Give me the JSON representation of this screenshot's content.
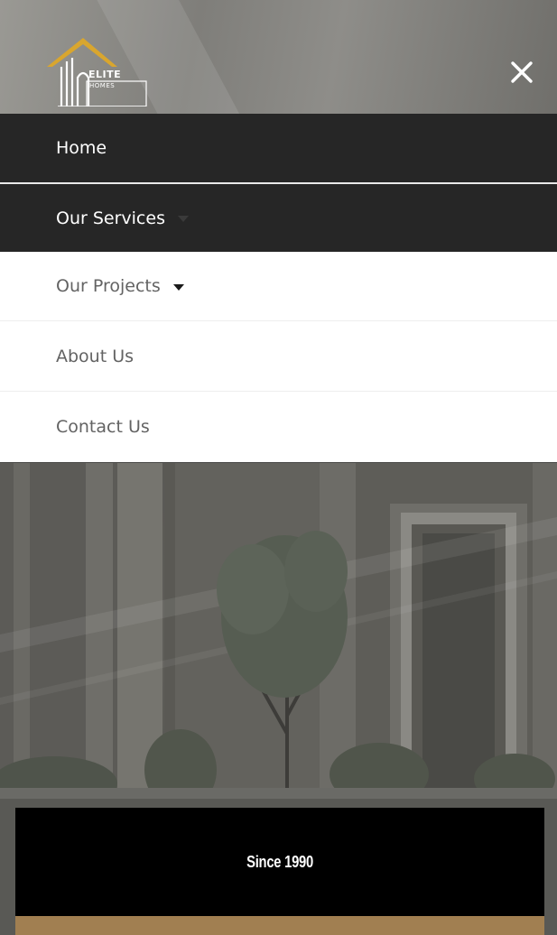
{
  "brand": {
    "logo_line1": "ELITE",
    "logo_line2": "HOMES",
    "logo_roof_color": "#d9a62e"
  },
  "header": {
    "close_icon": "close-icon",
    "close_glyph": "✕"
  },
  "nav": {
    "items": [
      {
        "label": "Home",
        "has_dropdown": false,
        "state": "active"
      },
      {
        "label": "Our Services",
        "has_dropdown": true,
        "state": "hover"
      },
      {
        "label": "Our Projects",
        "has_dropdown": true,
        "state": "default"
      },
      {
        "label": "About Us",
        "has_dropdown": false,
        "state": "default"
      },
      {
        "label": "Contact Us",
        "has_dropdown": false,
        "state": "default"
      }
    ]
  },
  "hero": {
    "since_label": "Since 1990"
  },
  "colors": {
    "menu_dark": "#262626",
    "menu_light": "#ffffff",
    "menu_text_light": "#636363",
    "accent_gold": "#a17f51",
    "banner_black": "#000000"
  }
}
